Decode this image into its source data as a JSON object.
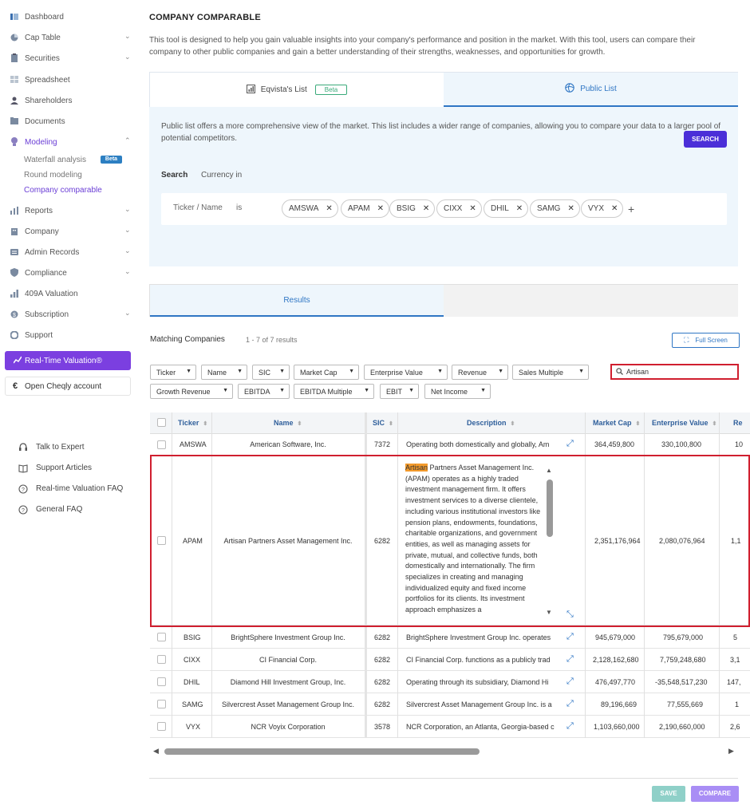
{
  "sidebar": {
    "items": [
      {
        "label": "Dashboard",
        "icon": "dashboard-icon",
        "chevron": ""
      },
      {
        "label": "Cap Table",
        "icon": "pie-chart-icon",
        "chevron": "⌄"
      },
      {
        "label": "Securities",
        "icon": "clipboard-icon",
        "chevron": "⌄"
      },
      {
        "label": "Spreadsheet",
        "icon": "spreadsheet-icon",
        "chevron": ""
      },
      {
        "label": "Shareholders",
        "icon": "user-icon",
        "chevron": ""
      },
      {
        "label": "Documents",
        "icon": "folder-icon",
        "chevron": ""
      },
      {
        "label": "Modeling",
        "icon": "bulb-icon",
        "chevron": "⌃"
      },
      {
        "label": "Reports",
        "icon": "chart-icon",
        "chevron": "⌄"
      },
      {
        "label": "Company",
        "icon": "building-icon",
        "chevron": "⌄"
      },
      {
        "label": "Admin Records",
        "icon": "records-icon",
        "chevron": "⌄"
      },
      {
        "label": "Compliance",
        "icon": "shield-icon",
        "chevron": "⌄"
      },
      {
        "label": "409A Valuation",
        "icon": "valuation-icon",
        "chevron": ""
      },
      {
        "label": "Subscription",
        "icon": "subscription-icon",
        "chevron": "⌄"
      },
      {
        "label": "Support",
        "icon": "support-icon",
        "chevron": ""
      }
    ],
    "modeling_sub": {
      "waterfall": "Waterfall analysis",
      "waterfall_badge": "Beta",
      "round": "Round modeling",
      "company_comparable": "Company comparable"
    },
    "realtime": "Real-Time Valuation®",
    "cheqly": "Open Cheqly account",
    "help": [
      {
        "label": "Talk to Expert",
        "icon": "headset-icon"
      },
      {
        "label": "Support Articles",
        "icon": "book-icon"
      },
      {
        "label": "Real-time Valuation FAQ",
        "icon": "question-icon"
      },
      {
        "label": "General FAQ",
        "icon": "question-icon"
      }
    ]
  },
  "page": {
    "title": "COMPANY COMPARABLE",
    "intro": "This tool is designed to help you gain valuable insights into your company's performance and position in the market. With this tool, users can compare their company to other public companies and gain a better understanding of their strengths, weaknesses, and opportunities for growth.",
    "tabs": {
      "eqvista": "Eqvista's List",
      "beta": "Beta",
      "public": "Public List"
    },
    "public_note": "Public list offers a more comprehensive view of the market. This list includes a wider range of companies, allowing you to compare your data to a larger pool of potential competitors.",
    "panel_tabs": {
      "search": "Search",
      "currency": "Currency in"
    },
    "filter": {
      "label": "Ticker / Name",
      "operator": "is",
      "chips": [
        "AMSWA",
        "APAM",
        "BSIG",
        "CIXX",
        "DHIL",
        "SAMG",
        "VYX"
      ],
      "add": "+"
    },
    "search_button": "SEARCH",
    "results_tab": "Results",
    "matching_label": "Matching Companies",
    "matching_count": "1 - 7 of 7 results",
    "full_screen": "Full Screen",
    "column_toggles": [
      "Ticker",
      "Name",
      "SIC",
      "Market Cap",
      "Enterprise Value",
      "Revenue",
      "Sales Multiple",
      "Growth Revenue",
      "EBITDA",
      "EBITDA Multiple",
      "EBIT",
      "Net Income"
    ],
    "table_search_value": "Artisan",
    "save": "SAVE",
    "compare": "COMPARE"
  },
  "table": {
    "headers": [
      "Ticker",
      "Name",
      "SIC",
      "Description",
      "Market Cap",
      "Enterprise Value",
      "Re"
    ],
    "rows": [
      {
        "ticker": "AMSWA",
        "name": "American Software, Inc.",
        "sic": "7372",
        "description": "Operating both domestically and globally, Am",
        "market_cap": "364,459,800",
        "ev": "330,100,800",
        "rev": "10"
      },
      {
        "ticker": "APAM",
        "name": "Artisan Partners Asset Management Inc.",
        "sic": "6282",
        "description": "",
        "market_cap": "2,351,176,964",
        "ev": "2,080,076,964",
        "rev": "1,1"
      },
      {
        "ticker": "BSIG",
        "name": "BrightSphere Investment Group Inc.",
        "sic": "6282",
        "description": "BrightSphere Investment Group Inc. operates",
        "market_cap": "945,679,000",
        "ev": "795,679,000",
        "rev": "5"
      },
      {
        "ticker": "CIXX",
        "name": "CI Financial Corp.",
        "sic": "6282",
        "description": "CI Financial Corp. functions as a publicly trad",
        "market_cap": "2,128,162,680",
        "ev": "7,759,248,680",
        "rev": "3,1"
      },
      {
        "ticker": "DHIL",
        "name": "Diamond Hill Investment Group, Inc.",
        "sic": "6282",
        "description": "Operating through its subsidiary, Diamond Hi",
        "market_cap": "476,497,770",
        "ev": "-35,548,517,230",
        "rev": "147,"
      },
      {
        "ticker": "SAMG",
        "name": "Silvercrest Asset Management Group Inc.",
        "sic": "6282",
        "description": "Silvercrest Asset Management Group Inc. is a",
        "market_cap": "89,196,669",
        "ev": "77,555,669",
        "rev": "1"
      },
      {
        "ticker": "VYX",
        "name": "NCR Voyix Corporation",
        "sic": "3578",
        "description": "NCR Corporation, an Atlanta, Georgia-based c",
        "market_cap": "1,103,660,000",
        "ev": "2,190,660,000",
        "rev": "2,6"
      }
    ],
    "expanded_description": {
      "highlight": "Artisan",
      "text": " Partners Asset Management Inc. (APAM) operates as a highly traded investment management firm. It offers investment services to a diverse clientele, including various institutional investors like pension plans, endowments, foundations, charitable organizations, and government entities, as well as managing assets for private, mutual, and collective funds, both domestically and internationally. The firm specializes in creating and managing individualized equity and fixed income portfolios for its clients. Its investment approach emphasizes a"
    }
  },
  "colors": {
    "accent": "#6b3fd6",
    "blue": "#2f76c4",
    "highlight_border": "#d01f2f",
    "search_btn": "#4b2fd8"
  }
}
